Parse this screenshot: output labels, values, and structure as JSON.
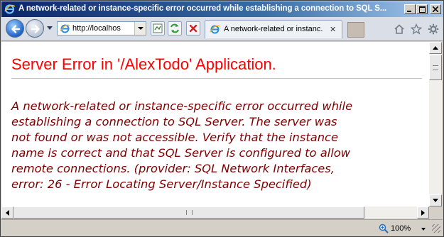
{
  "window": {
    "title": "A network-related or instance-specific error occurred while establishing a connection to SQL S..."
  },
  "toolbar": {
    "address_value": "http://localhost:"
  },
  "tab": {
    "label": "A network-related or instanc...",
    "close_glyph": "✕"
  },
  "page": {
    "title": "Server Error in '/AlexTodo' Application.",
    "error_lines": [
      "A network-related or instance-specific error occurred while",
      "establishing a connection to SQL Server. The server was",
      "not found or was not accessible. Verify that the instance",
      "name is correct and that SQL Server is configured to allow",
      "remote connections. (provider: SQL Network Interfaces,",
      "error: 26 - Error Locating Server/Instance Specified)"
    ]
  },
  "statusbar": {
    "zoom": "100%"
  },
  "icons": {
    "app": "ie-icon",
    "back": "back-arrow-icon",
    "forward": "forward-arrow-icon",
    "compat": "compatibility-view-icon",
    "refresh": "refresh-icon",
    "stop": "stop-icon",
    "home": "home-icon",
    "favorites": "star-icon",
    "tools": "gear-icon"
  },
  "colors": {
    "title_text": "#ff0000",
    "error_text": "#800000",
    "titlebar_start": "#0a246a",
    "titlebar_end": "#a6caf0"
  }
}
